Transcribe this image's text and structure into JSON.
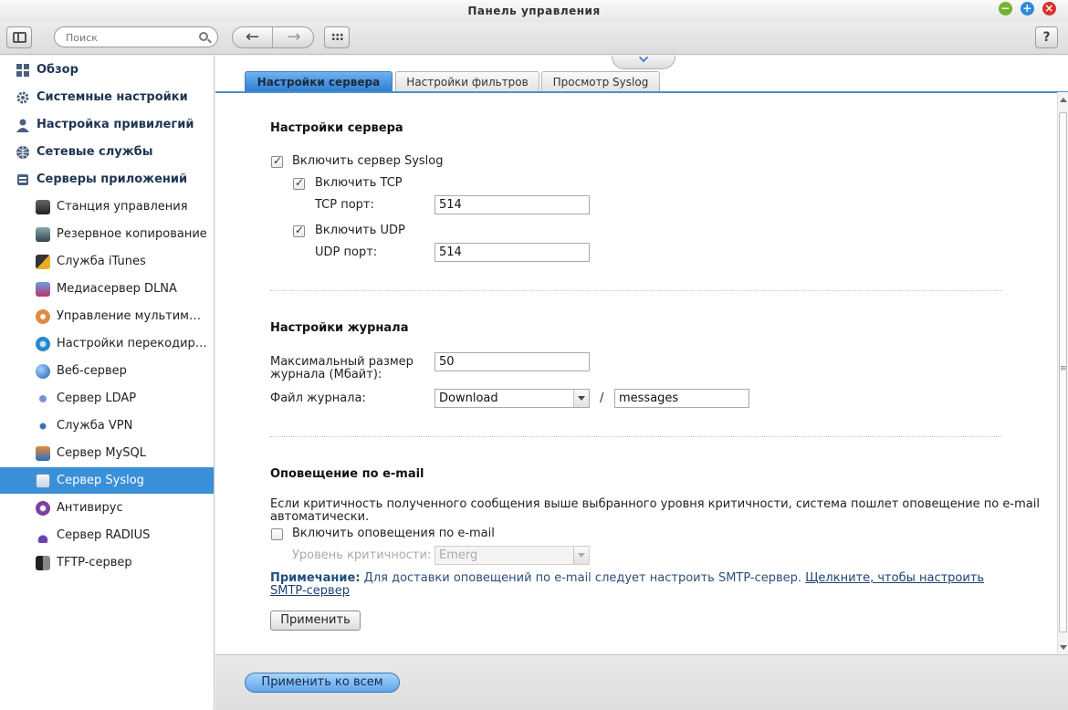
{
  "window": {
    "title": "Панель управления"
  },
  "toolbar": {
    "search_placeholder": "Поиск",
    "back": "←",
    "forward": "→",
    "help": "?"
  },
  "sidebar": {
    "top_items": [
      {
        "label": "Обзор",
        "icon": "overview-icon"
      },
      {
        "label": "Системные настройки",
        "icon": "gear-icon"
      },
      {
        "label": "Настройка привилегий",
        "icon": "user-icon"
      },
      {
        "label": "Сетевые службы",
        "icon": "network-icon"
      },
      {
        "label": "Серверы приложений",
        "icon": "server-icon"
      }
    ],
    "sub_items": [
      {
        "label": "Станция управления",
        "icon": "station-icon"
      },
      {
        "label": "Резервное копирование",
        "icon": "backup-icon"
      },
      {
        "label": "Служба iTunes",
        "icon": "itunes-icon"
      },
      {
        "label": "Медиасервер DLNA",
        "icon": "dlna-icon"
      },
      {
        "label": "Управление мультимедиа",
        "icon": "multimedia-icon"
      },
      {
        "label": "Настройки перекодирования",
        "icon": "transcode-icon"
      },
      {
        "label": "Веб-сервер",
        "icon": "globe-icon"
      },
      {
        "label": "Сервер LDAP",
        "icon": "ldap-icon"
      },
      {
        "label": "Служба VPN",
        "icon": "vpn-icon"
      },
      {
        "label": "Сервер MySQL",
        "icon": "mysql-icon"
      },
      {
        "label": "Сервер Syslog",
        "icon": "syslog-icon",
        "active": true
      },
      {
        "label": "Антивирус",
        "icon": "antivirus-icon"
      },
      {
        "label": "Сервер RADIUS",
        "icon": "radius-icon"
      },
      {
        "label": "TFTP-сервер",
        "icon": "tftp-icon"
      }
    ]
  },
  "tabs": [
    {
      "label": "Настройки сервера",
      "active": true
    },
    {
      "label": "Настройки фильтров"
    },
    {
      "label": "Просмотр Syslog"
    }
  ],
  "server_settings": {
    "title": "Настройки сервера",
    "enable_syslog": "Включить сервер Syslog",
    "enable_tcp": "Включить TCP",
    "tcp_port_label": "TCP порт:",
    "tcp_port": "514",
    "enable_udp": "Включить UDP",
    "udp_port_label": "UDP порт:",
    "udp_port": "514"
  },
  "log_settings": {
    "title": "Настройки журнала",
    "max_size_label_1": "Максимальный размер",
    "max_size_label_2": "журнала (Мбайт):",
    "max_size": "50",
    "file_label": "Файл журнала:",
    "folder": "Download",
    "separator": "/",
    "file_name": "messages"
  },
  "email": {
    "title": "Оповещение по e-mail",
    "description_1": "Если критичность полученного сообщения выше выбранного уровня критичности, система пошлет оповещение по e-mail",
    "description_2": "автоматически.",
    "enable_label": "Включить оповещения по e-mail",
    "severity_label": "Уровень критичности:",
    "severity_value": "Emerg",
    "note_label": "Примечание:",
    "note_text": " Для доставки оповещений по e-mail следует настроить SMTP-сервер. ",
    "note_link_1": "Щелкните, чтобы настроить",
    "note_link_2": "SMTP-сервер"
  },
  "buttons": {
    "apply": "Применить",
    "apply_all": "Применить ко всем"
  },
  "colors": {
    "accent": "#3a8fd9",
    "tab_active": "#2f7fcf"
  }
}
